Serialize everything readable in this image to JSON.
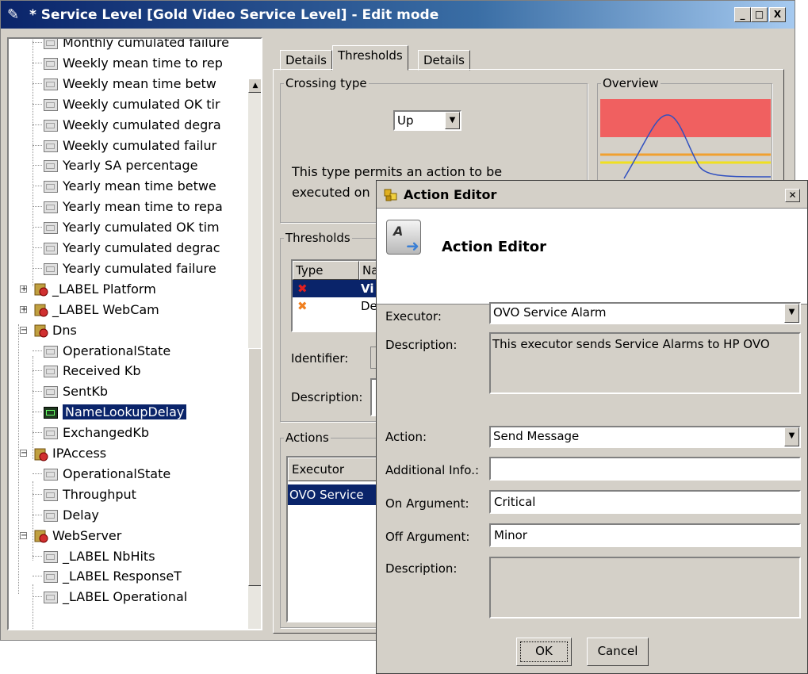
{
  "main_window": {
    "title": "* Service Level [Gold Video Service Level] - Edit mode",
    "controls": {
      "minimize": "_",
      "maximize": "□",
      "close": "X"
    }
  },
  "tree": {
    "items": [
      {
        "label": "Monthly cumulated failure",
        "type": "leaf"
      },
      {
        "label": "Weekly mean time to rep",
        "type": "leaf"
      },
      {
        "label": "Weekly mean time betw",
        "type": "leaf"
      },
      {
        "label": "Weekly cumulated OK tir",
        "type": "leaf"
      },
      {
        "label": "Weekly cumulated degra",
        "type": "leaf"
      },
      {
        "label": "Weekly cumulated failur",
        "type": "leaf"
      },
      {
        "label": "Yearly SA percentage",
        "type": "leaf"
      },
      {
        "label": "Yearly mean time betwe",
        "type": "leaf"
      },
      {
        "label": "Yearly mean time to repa",
        "type": "leaf"
      },
      {
        "label": "Yearly cumulated OK tim",
        "type": "leaf"
      },
      {
        "label": "Yearly cumulated degrac",
        "type": "leaf"
      },
      {
        "label": "Yearly cumulated failure",
        "type": "leaf"
      },
      {
        "label": "_LABEL Platform",
        "type": "group"
      },
      {
        "label": "_LABEL WebCam",
        "type": "group"
      },
      {
        "label": "Dns",
        "type": "group"
      },
      {
        "label": "OperationalState",
        "type": "leaf"
      },
      {
        "label": "Received Kb",
        "type": "leaf"
      },
      {
        "label": "SentKb",
        "type": "leaf"
      },
      {
        "label": "NameLookupDelay",
        "type": "leaf",
        "selected": true
      },
      {
        "label": "ExchangedKb",
        "type": "leaf"
      },
      {
        "label": "IPAccess",
        "type": "group"
      },
      {
        "label": "OperationalState",
        "type": "leaf"
      },
      {
        "label": "Throughput",
        "type": "leaf"
      },
      {
        "label": "Delay",
        "type": "leaf"
      },
      {
        "label": "WebServer",
        "type": "group"
      },
      {
        "label": "_LABEL NbHits",
        "type": "leaf"
      },
      {
        "label": "_LABEL ResponseT",
        "type": "leaf"
      },
      {
        "label": "_LABEL Operational",
        "type": "leaf"
      }
    ]
  },
  "tabs": [
    {
      "label": "Details"
    },
    {
      "label": "Thresholds",
      "active": true
    },
    {
      "label": "Details"
    }
  ],
  "crossing": {
    "legend": "Crossing type",
    "value": "Up",
    "description_line1": "This type permits an action to be",
    "description_line2": "executed on"
  },
  "overview": {
    "legend": "Overview"
  },
  "thresholds": {
    "legend": "Thresholds",
    "col_type": "Type",
    "col_name": "Na",
    "rows": [
      {
        "name": "Vi",
        "color": "#e02020"
      },
      {
        "name": "De",
        "color": "#f08020"
      }
    ],
    "identifier_label": "Identifier:",
    "description_label": "Description:"
  },
  "actions": {
    "legend": "Actions",
    "col_executor": "Executor",
    "row_value": "OVO Service"
  },
  "dialog": {
    "title": "Action Editor",
    "header": "Action Editor",
    "icon_letter": "A",
    "executor_label": "Executor:",
    "executor_value": "OVO Service Alarm",
    "description_label": "Description:",
    "description_value": "This executor sends Service Alarms to HP OVO",
    "action_label": "Action:",
    "action_value": "Send Message",
    "additional_info_label": "Additional Info.:",
    "additional_info_value": "",
    "on_argument_label": "On Argument:",
    "on_argument_value": "Critical",
    "off_argument_label": "Off Argument:",
    "off_argument_value": "Minor",
    "description2_label": "Description:",
    "description2_value": "",
    "ok_label": "OK",
    "cancel_label": "Cancel"
  },
  "colors": {
    "title_bar": "#0a246a",
    "selection": "#0a246a",
    "overview_red": "#f06060",
    "overview_orange": "#f0a030",
    "overview_yellow": "#f0e020",
    "overview_green": "#30a030",
    "overview_curve": "#3050c0"
  }
}
